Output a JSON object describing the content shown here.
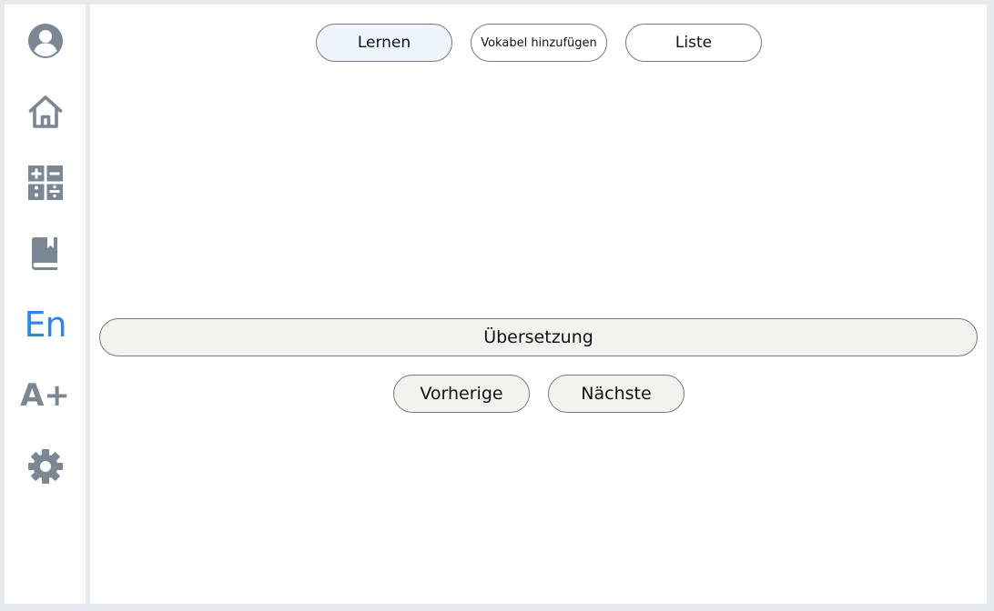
{
  "sidebar": {
    "items": [
      {
        "icon": "user-avatar-icon"
      },
      {
        "icon": "home-icon"
      },
      {
        "icon": "math-operations-icon"
      },
      {
        "icon": "book-bookmark-icon"
      },
      {
        "icon": "language-icon",
        "text": "En",
        "color": "#2f86e4"
      },
      {
        "icon": "font-size-increase-icon",
        "text": "A+"
      },
      {
        "icon": "gear-icon"
      }
    ],
    "icon_color": "#7b8793"
  },
  "tabs": [
    {
      "label": "Lernen",
      "active": true
    },
    {
      "label": "Vokabel hinzufügen",
      "active": false
    },
    {
      "label": "Liste",
      "active": false
    }
  ],
  "card": {
    "translation_label": "Übersetzung"
  },
  "navigation": {
    "previous_label": "Vorherige",
    "next_label": "Nächste"
  },
  "colors": {
    "background": "#e8ebee",
    "active_tab": "#eef5fd",
    "button_fill": "#f3f2ef",
    "accent": "#2f86e4"
  }
}
